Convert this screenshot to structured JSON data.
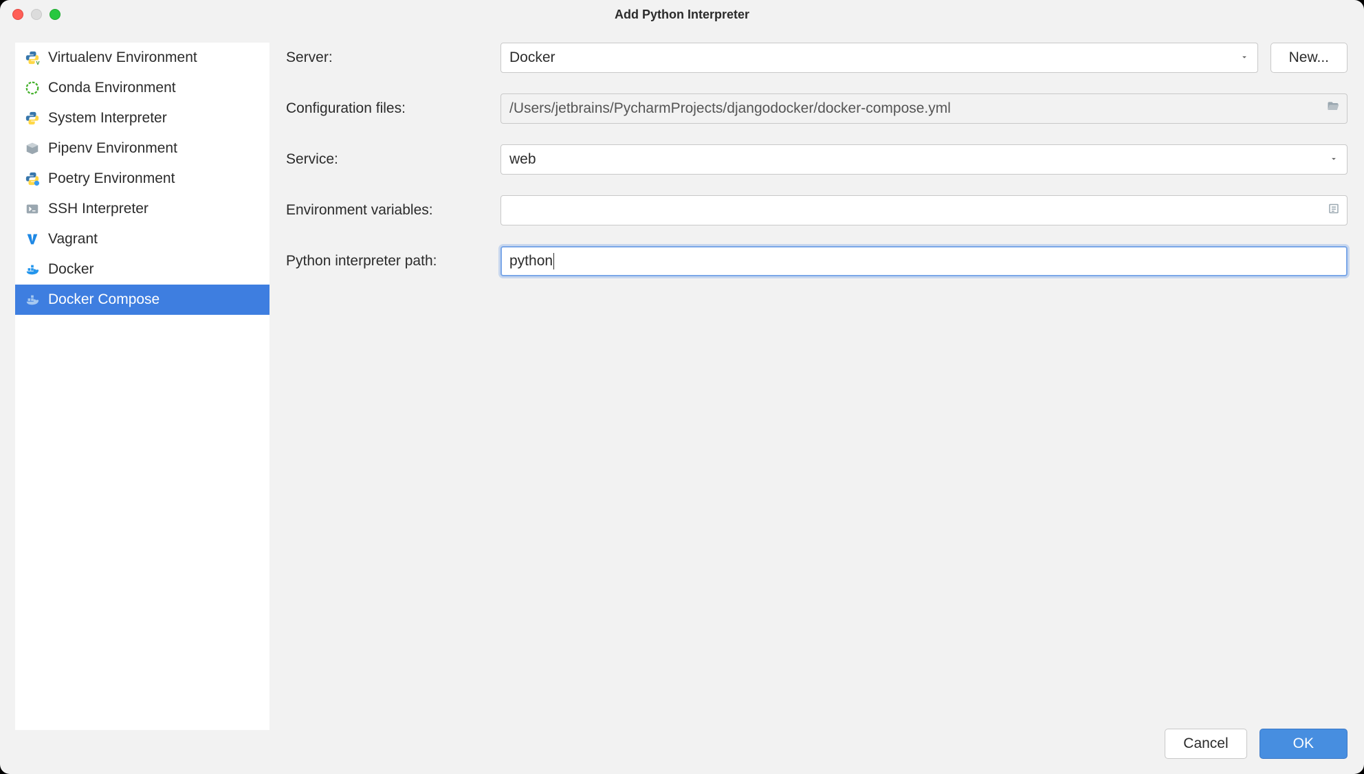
{
  "window": {
    "title": "Add Python Interpreter"
  },
  "sidebar": {
    "items": [
      {
        "label": "Virtualenv Environment",
        "icon": "python-v-icon"
      },
      {
        "label": "Conda Environment",
        "icon": "conda-icon"
      },
      {
        "label": "System Interpreter",
        "icon": "python-icon"
      },
      {
        "label": "Pipenv Environment",
        "icon": "pipenv-icon"
      },
      {
        "label": "Poetry Environment",
        "icon": "poetry-icon"
      },
      {
        "label": "SSH Interpreter",
        "icon": "ssh-icon"
      },
      {
        "label": "Vagrant",
        "icon": "vagrant-icon"
      },
      {
        "label": "Docker",
        "icon": "docker-icon"
      },
      {
        "label": "Docker Compose",
        "icon": "docker-compose-icon"
      }
    ],
    "selected_index": 8
  },
  "form": {
    "server": {
      "label": "Server:",
      "value": "Docker",
      "new_button": "New..."
    },
    "config": {
      "label": "Configuration files:",
      "value": "/Users/jetbrains/PycharmProjects/djangodocker/docker-compose.yml"
    },
    "service": {
      "label": "Service:",
      "value": "web"
    },
    "env": {
      "label": "Environment variables:",
      "value": ""
    },
    "path": {
      "label": "Python interpreter path:",
      "value": "python"
    }
  },
  "footer": {
    "cancel": "Cancel",
    "ok": "OK"
  }
}
